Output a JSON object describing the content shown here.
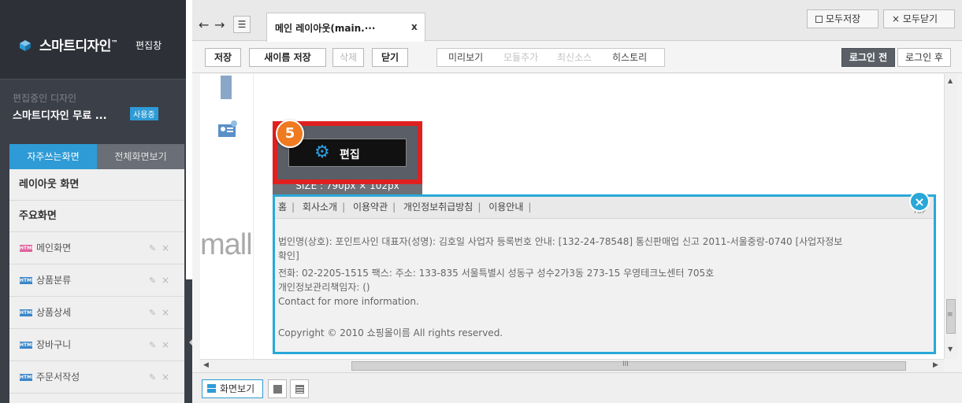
{
  "sidebar": {
    "logo_text": "스마트디자인",
    "logo_tm": "™",
    "logo_sub": "편집창",
    "design_label": "편집중인 디자인",
    "design_name": "스마트디자인 무료 ...",
    "design_badge": "사용중",
    "tabs": [
      {
        "label": "자주쓰는화면",
        "active": true
      },
      {
        "label": "전체화면보기",
        "active": false
      }
    ],
    "headers": [
      "레이아웃 화면",
      "주요화면"
    ],
    "items": [
      {
        "label": "메인화면",
        "icon": "html-page-icon-pink"
      },
      {
        "label": "상품분류",
        "icon": "html-page-icon"
      },
      {
        "label": "상품상세",
        "icon": "html-page-icon"
      },
      {
        "label": "장바구니",
        "icon": "html-page-icon"
      },
      {
        "label": "주문서작성",
        "icon": "html-page-icon"
      }
    ],
    "item_edit_glyph": "✎",
    "item_delete_glyph": "×"
  },
  "tabbar": {
    "back": "←",
    "forward": "→",
    "list_glyph": "☰",
    "doc_tab_label": "메인 레이아웃(main.···",
    "doc_tab_close": "x",
    "save_all": "모두저장",
    "close_all": "× 모두닫기"
  },
  "toolbar": {
    "save": "저장",
    "save_as": "새이름 저장",
    "delete": "삭제",
    "close": "닫기",
    "preview": "미리보기",
    "add_module": "모듈추가",
    "latest_source": "최신소스",
    "history": "히스토리",
    "login_before": "로그인 전",
    "login_after": "로그인 후"
  },
  "canvas": {
    "mall_text": "mall",
    "size_text": "SIZE : 790px × 102px",
    "edit_label": "편집",
    "step_number": "5",
    "footer_links": [
      "홈",
      "회사소개",
      "이용약관",
      "개인정보취급방침",
      "이용안내"
    ],
    "footer_to": "TOP",
    "footer_lines": [
      "법인명(상호): 포인트사인    대표자(성명): 김호일    사업자 등록번호 안내: [132-24-78548]    통신판매업 신고 2011-서울중랑-0740    [사업자정보",
      "확인]",
      "전화: 02-2205-1515    팩스:    주소: 133-835 서울특별시 성동구 성수2가3동 273-15 우영테크노센터 705호",
      "개인정보관리책임자: ()",
      "Contact for more information.",
      "Copyright © 2010 쇼핑몰이름 All rights reserved."
    ],
    "footer_close": "×"
  },
  "bottom": {
    "view_screen": "화면보기"
  },
  "colors": {
    "accent": "#2e9bd6",
    "highlight_frame": "#e02020",
    "step_badge": "#f07a20",
    "selection_border": "#29a8d8"
  }
}
